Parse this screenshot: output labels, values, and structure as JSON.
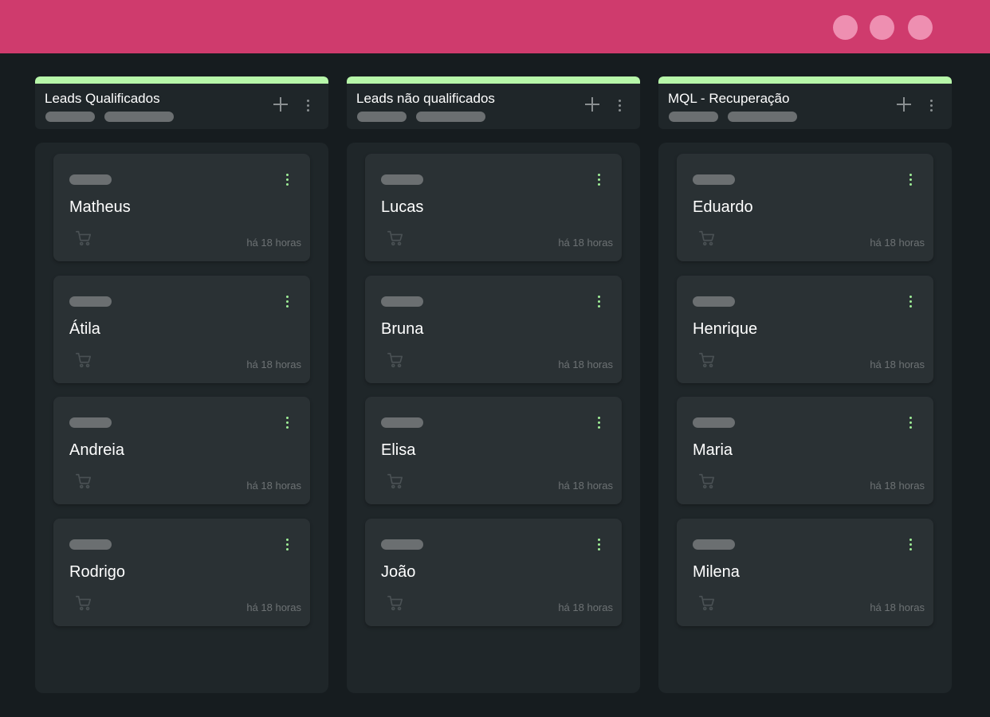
{
  "window": {
    "controls": [
      "window-control-1",
      "window-control-2",
      "window-control-3"
    ]
  },
  "columns": [
    {
      "title": "Leads Qualificados",
      "cards": [
        {
          "name": "Matheus",
          "time": "há 18 horas"
        },
        {
          "name": "Átila",
          "time": "há 18 horas"
        },
        {
          "name": "Andreia",
          "time": "há 18 horas"
        },
        {
          "name": "Rodrigo",
          "time": "há 18 horas"
        }
      ]
    },
    {
      "title": "Leads não qualificados",
      "cards": [
        {
          "name": "Lucas",
          "time": "há 18 horas"
        },
        {
          "name": "Bruna",
          "time": "há 18 horas"
        },
        {
          "name": "Elisa",
          "time": "há 18 horas"
        },
        {
          "name": "João",
          "time": "há 18 horas"
        }
      ]
    },
    {
      "title": "MQL - Recuperação",
      "cards": [
        {
          "name": "Eduardo",
          "time": "há 18 horas"
        },
        {
          "name": "Henrique",
          "time": "há 18 horas"
        },
        {
          "name": "Maria",
          "time": "há 18 horas"
        },
        {
          "name": "Milena",
          "time": "há 18 horas"
        }
      ]
    }
  ],
  "colors": {
    "titlebar": "#cf3b6d",
    "window_dot": "#ee8fb1",
    "column_accent": "#b7f7a9",
    "card_menu_dots": "#9ff097",
    "background": "#161c1f"
  },
  "icons": {
    "add": "plus-icon",
    "column_menu": "more-vertical-icon",
    "card_menu": "more-vertical-icon",
    "card_action": "cart-icon"
  }
}
